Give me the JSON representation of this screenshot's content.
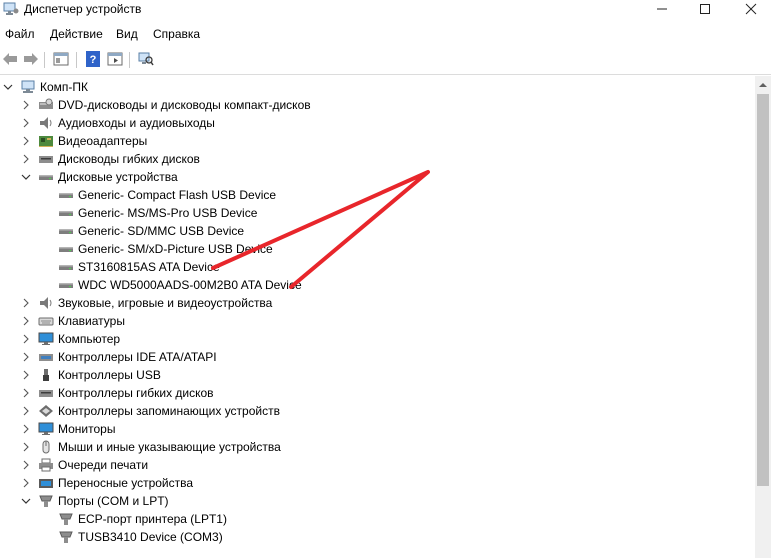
{
  "window": {
    "title": "Диспетчер устройств",
    "icons": {
      "app": "device-manager-icon",
      "minimize": "minimize-icon",
      "maximize": "maximize-icon",
      "close": "close-icon"
    }
  },
  "menu": [
    "Файл",
    "Действие",
    "Вид",
    "Справка"
  ],
  "toolbar": {
    "icons": [
      "back-arrow-icon",
      "forward-arrow-icon",
      "properties-icon",
      "help-icon",
      "show-hide-console-tree-icon",
      "scan-hardware-icon"
    ]
  },
  "tree": {
    "root": {
      "label": "Комп-ПК",
      "icon": "computer-icon",
      "expanded": true
    },
    "rows": [
      {
        "label": "DVD-дисководы и дисководы компакт-дисков",
        "icon": "dvd-drive-icon",
        "level": 1,
        "expander": "collapsed"
      },
      {
        "label": "Аудиовходы и аудиовыходы",
        "icon": "speaker-icon",
        "level": 1,
        "expander": "collapsed"
      },
      {
        "label": "Видеоадаптеры",
        "icon": "display-adapter-icon",
        "level": 1,
        "expander": "collapsed"
      },
      {
        "label": "Дисководы гибких дисков",
        "icon": "floppy-drive-icon",
        "level": 1,
        "expander": "collapsed"
      },
      {
        "label": "Дисковые устройства",
        "icon": "disk-drive-icon",
        "level": 1,
        "expander": "expanded"
      },
      {
        "label": "Generic- Compact Flash USB Device",
        "icon": "disk-drive-icon",
        "level": 2,
        "expander": "none"
      },
      {
        "label": "Generic- MS/MS-Pro USB Device",
        "icon": "disk-drive-icon",
        "level": 2,
        "expander": "none"
      },
      {
        "label": "Generic- SD/MMC USB Device",
        "icon": "disk-drive-icon",
        "level": 2,
        "expander": "none"
      },
      {
        "label": "Generic- SM/xD-Picture USB Device",
        "icon": "disk-drive-icon",
        "level": 2,
        "expander": "none"
      },
      {
        "label": "ST3160815AS ATA Device",
        "icon": "disk-drive-icon",
        "level": 2,
        "expander": "none"
      },
      {
        "label": "WDC WD5000AADS-00M2B0 ATA Device",
        "icon": "disk-drive-icon",
        "level": 2,
        "expander": "none"
      },
      {
        "label": "Звуковые, игровые и видеоустройства",
        "icon": "speaker-icon",
        "level": 1,
        "expander": "collapsed"
      },
      {
        "label": "Клавиатуры",
        "icon": "keyboard-icon",
        "level": 1,
        "expander": "collapsed"
      },
      {
        "label": "Компьютер",
        "icon": "monitor-icon",
        "level": 1,
        "expander": "collapsed"
      },
      {
        "label": "Контроллеры IDE ATA/ATAPI",
        "icon": "ide-controller-icon",
        "level": 1,
        "expander": "collapsed"
      },
      {
        "label": "Контроллеры USB",
        "icon": "usb-icon",
        "level": 1,
        "expander": "collapsed"
      },
      {
        "label": "Контроллеры гибких дисков",
        "icon": "floppy-drive-icon",
        "level": 1,
        "expander": "collapsed"
      },
      {
        "label": "Контроллеры запоминающих устройств",
        "icon": "storage-controller-icon",
        "level": 1,
        "expander": "collapsed"
      },
      {
        "label": "Мониторы",
        "icon": "monitor-icon",
        "level": 1,
        "expander": "collapsed"
      },
      {
        "label": "Мыши и иные указывающие устройства",
        "icon": "mouse-icon",
        "level": 1,
        "expander": "collapsed"
      },
      {
        "label": "Очереди печати",
        "icon": "printer-icon",
        "level": 1,
        "expander": "collapsed"
      },
      {
        "label": "Переносные устройства",
        "icon": "portable-device-icon",
        "level": 1,
        "expander": "collapsed"
      },
      {
        "label": "Порты (COM и LPT)",
        "icon": "port-icon",
        "level": 1,
        "expander": "expanded"
      },
      {
        "label": "ECP-порт принтера (LPT1)",
        "icon": "port-icon",
        "level": 2,
        "expander": "none"
      },
      {
        "label": "TUSB3410 Device (COM3)",
        "icon": "port-icon",
        "level": 2,
        "expander": "none"
      }
    ]
  },
  "annotation": {
    "color": "#e8262b"
  },
  "colors": {
    "accent_blue": "#1e6fd9",
    "toolbar_border": "#dcdcdc"
  }
}
